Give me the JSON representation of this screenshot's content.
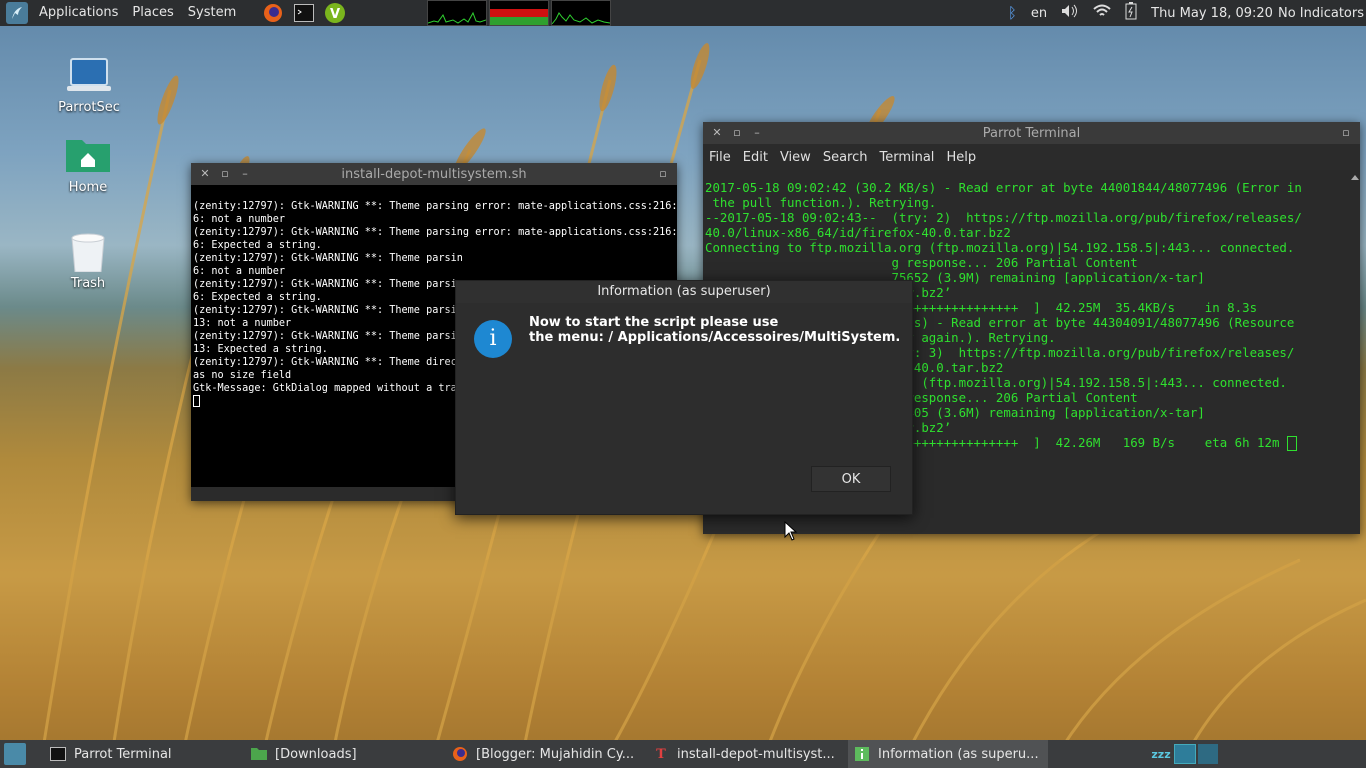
{
  "top_panel": {
    "menus": [
      "Applications",
      "Places",
      "System"
    ],
    "clock": "Thu May 18, 09:20",
    "indicators": "No Indicators",
    "keyboard_layout": "en"
  },
  "desktop": {
    "icons": [
      {
        "label": "ParrotSec"
      },
      {
        "label": "Home"
      },
      {
        "label": "Trash"
      }
    ]
  },
  "install_window": {
    "title": "install-depot-multisystem.sh",
    "lines": [
      "(zenity:12797): Gtk-WARNING **: Theme parsing error: mate-applications.css:216:1",
      "6: not a number",
      "",
      "(zenity:12797): Gtk-WARNING **: Theme parsing error: mate-applications.css:216:1",
      "6: Expected a string.",
      "",
      "(zenity:12797): Gtk-WARNING **: Theme parsin",
      "6: not a number",
      "",
      "(zenity:12797): Gtk-WARNING **: Theme parsin",
      "6: Expected a string.",
      "",
      "(zenity:12797): Gtk-WARNING **: Theme parsin",
      "13: not a number",
      "",
      "(zenity:12797): Gtk-WARNING **: Theme parsin",
      "13: Expected a string.",
      "",
      "(zenity:12797): Gtk-WARNING **: Theme direct",
      "as no size field",
      "",
      "Gtk-Message: GtkDialog mapped without a tran"
    ]
  },
  "parrot_terminal": {
    "title": "Parrot Terminal",
    "menu": [
      "File",
      "Edit",
      "View",
      "Search",
      "Terminal",
      "Help"
    ],
    "lines": [
      "2017-05-18 09:02:42 (30.2 KB/s) - Read error at byte 44001844/48077496 (Error in",
      " the pull function.). Retrying.",
      "",
      "--2017-05-18 09:02:43--  (try: 2)  https://ftp.mozilla.org/pub/firefox/releases/",
      "40.0/linux-x86_64/id/firefox-40.0.tar.bz2",
      "Connecting to ftp.mozilla.org (ftp.mozilla.org)|54.192.158.5|:443... connected.",
      "                         g response... 206 Partial Content",
      "                         75652 (3.9M) remaining [application/x-tar]",
      "                         tar.bz2’",
      "",
      "                         +++++++++++++++++  ]  42.25M  35.4KB/s    in 8.3s",
      "",
      "                         KB/s) - Read error at byte 44304091/48077496 (Resource",
      "                         try again.). Retrying.",
      "",
      "                         try: 3)  https://ftp.mozilla.org/pub/firefox/releases/",
      "                         ox-40.0.tar.bz2",
      "                         org (ftp.mozilla.org)|54.192.158.5|:443... connected.",
      "                         g response... 206 Partial Content",
      "                         73405 (3.6M) remaining [application/x-tar]",
      "                         tar.bz2’",
      "",
      "firefox-40.0.tar.bz  92%[+++++++++++++++++  ]  42.26M   169 B/s    eta 6h 12m "
    ]
  },
  "dialog": {
    "title": "Information (as superuser)",
    "message_line1": "Now to start the script please use",
    "message_line2": "the menu: / Applications/Accessoires/MultiSystem.",
    "ok_label": "OK"
  },
  "taskbar": {
    "tasks": [
      {
        "label": "Parrot Terminal",
        "icon": "terminal-icon"
      },
      {
        "label": "[Downloads]",
        "icon": "folder-icon"
      },
      {
        "label": "[Blogger: Mujahidin Cy...",
        "icon": "firefox-icon"
      },
      {
        "label": "install-depot-multisyst...",
        "icon": "text-editor-icon"
      },
      {
        "label": "Information (as superu...",
        "icon": "info-icon"
      }
    ]
  },
  "colors": {
    "panel": "#2c2e30",
    "terminal_green": "#2fe02f",
    "info_blue": "#1e88d2"
  }
}
